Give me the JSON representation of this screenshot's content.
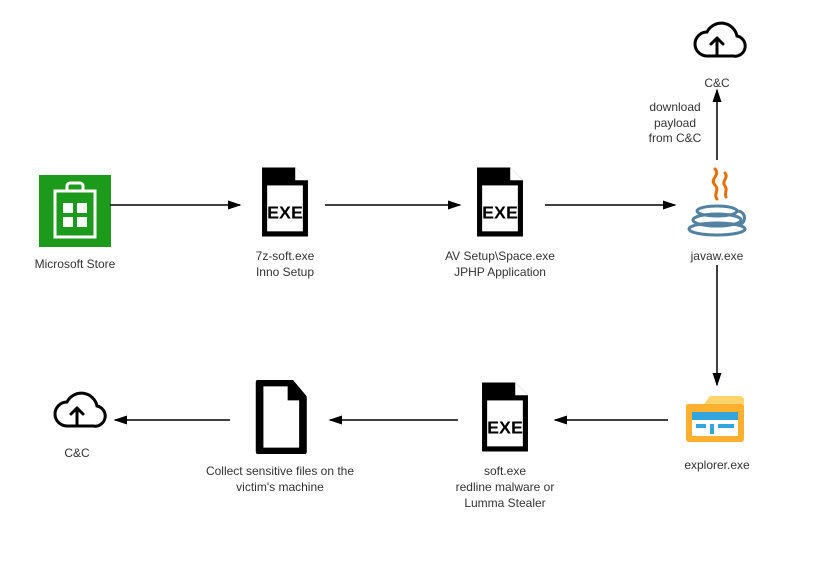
{
  "nodes": {
    "msstore": {
      "label1": "Microsoft Store",
      "label2": ""
    },
    "sevenz": {
      "label1": "7z-soft.exe",
      "label2": "Inno Setup"
    },
    "avsetup": {
      "label1": "AV Setup\\Space.exe",
      "label2": "JPHP Application"
    },
    "javaw": {
      "label1": "javaw.exe",
      "label2": ""
    },
    "cc_top": {
      "label1": "C&C",
      "label2": ""
    },
    "explorer": {
      "label1": "explorer.exe",
      "label2": ""
    },
    "softexe": {
      "label1": "soft.exe",
      "label2": "redline malware or",
      "label3": "Lumma Stealer"
    },
    "collect": {
      "label1": "Collect sensitive files on the",
      "label2": "victim's machine"
    },
    "cc_bottom": {
      "label1": "C&C",
      "label2": ""
    }
  },
  "edges": {
    "download": {
      "line1": "download",
      "line2": "payload",
      "line3": "from C&C"
    }
  }
}
